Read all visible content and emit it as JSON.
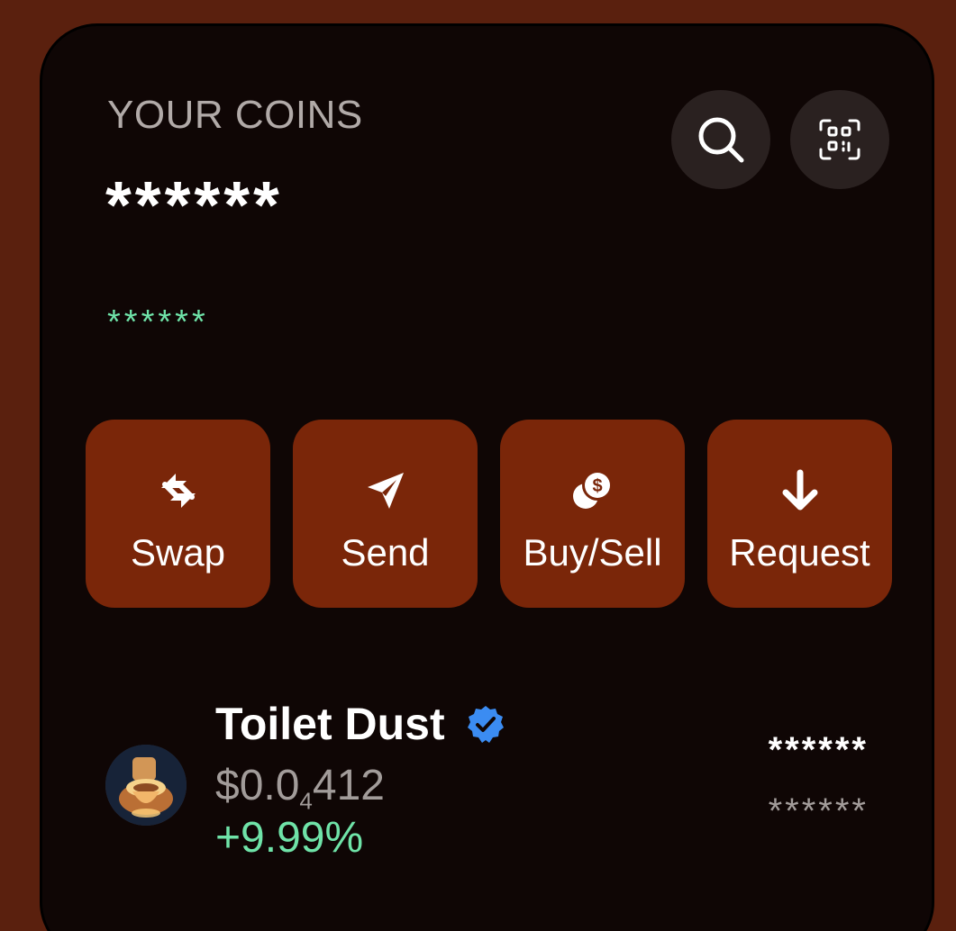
{
  "header": {
    "title": "YOUR COINS",
    "balance": "******",
    "balance_change": "******",
    "search_icon": "search-icon",
    "scan_icon": "qr-scan-icon"
  },
  "actions": [
    {
      "label": "Swap",
      "icon": "swap-arrows-icon"
    },
    {
      "label": "Send",
      "icon": "paper-plane-icon"
    },
    {
      "label": "Buy/Sell",
      "icon": "coins-dollar-icon"
    },
    {
      "label": "Request",
      "icon": "arrow-down-icon"
    }
  ],
  "coins": [
    {
      "name": "Toilet Dust",
      "verified": true,
      "price_prefix": "$0.0",
      "price_subscript": "4",
      "price_suffix": "412",
      "change": "+9.99%",
      "value": "******",
      "amount": "******"
    }
  ],
  "colors": {
    "background": "#5a200e",
    "panel": "#0f0605",
    "action_button": "#7a2609",
    "positive": "#6fe3a8",
    "verified_badge": "#3b8cf2"
  }
}
